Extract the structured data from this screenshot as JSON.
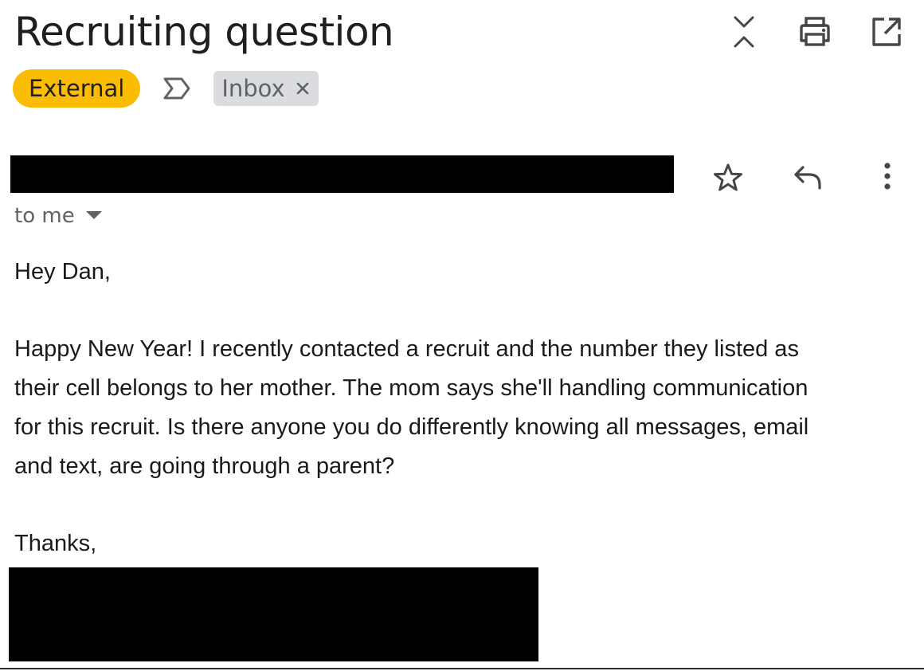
{
  "email": {
    "subject": "Recruiting question",
    "labels": {
      "external": "External",
      "inbox": "Inbox"
    },
    "recipient_label": "to me",
    "body": {
      "greeting": "Hey Dan,",
      "paragraph_line_1": "Happy New Year! I recently contacted a recruit and the number they listed as",
      "paragraph_line_2": "their cell belongs to her mother. The mom says she'll handling communication",
      "paragraph_line_3": "for this recruit. Is there anyone you do differently knowing all messages, email",
      "paragraph_line_4": "and text, are going through a parent?",
      "closing": "Thanks,"
    }
  },
  "icons": {
    "top_toolbar": [
      "expand-collapse-icon",
      "print-icon",
      "open-in-new-window-icon"
    ],
    "label_row": [
      "importance-marker-icon",
      "remove-label-icon"
    ],
    "message_actions": [
      "star-icon",
      "reply-icon",
      "more-options-icon"
    ],
    "recipient": "chevron-down-icon"
  },
  "colors": {
    "external_label_bg": "#fbbc04",
    "inbox_label_bg": "#dadce0",
    "icon_color": "#444746",
    "redaction": "#000000"
  }
}
